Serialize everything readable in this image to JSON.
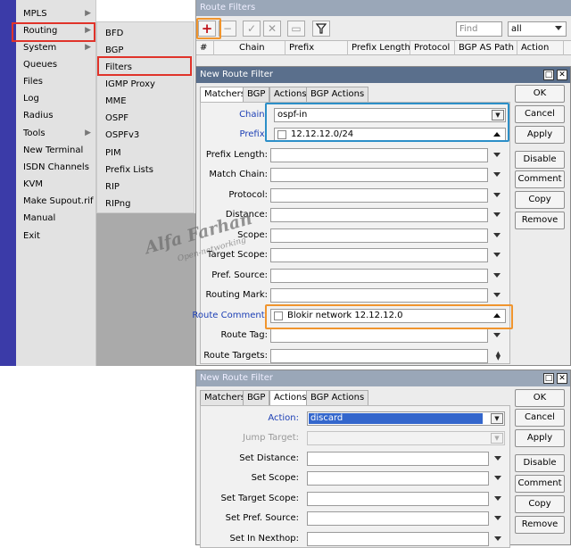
{
  "menu": {
    "items": [
      {
        "label": "MPLS",
        "arrow": true
      },
      {
        "label": "Routing",
        "arrow": true
      },
      {
        "label": "System",
        "arrow": true
      },
      {
        "label": "Queues",
        "arrow": false
      },
      {
        "label": "Files",
        "arrow": false
      },
      {
        "label": "Log",
        "arrow": false
      },
      {
        "label": "Radius",
        "arrow": false
      },
      {
        "label": "Tools",
        "arrow": true
      },
      {
        "label": "New Terminal",
        "arrow": false
      },
      {
        "label": "ISDN Channels",
        "arrow": false
      },
      {
        "label": "KVM",
        "arrow": false
      },
      {
        "label": "Make Supout.rif",
        "arrow": false
      },
      {
        "label": "Manual",
        "arrow": false
      },
      {
        "label": "Exit",
        "arrow": false
      }
    ]
  },
  "submenu": {
    "items": [
      "BFD",
      "BGP",
      "Filters",
      "IGMP Proxy",
      "MME",
      "OSPF",
      "OSPFv3",
      "PIM",
      "Prefix Lists",
      "RIP",
      "RIPng"
    ]
  },
  "route_filters": {
    "title": "Route Filters",
    "find_placeholder": "Find",
    "filter_value": "all",
    "columns": [
      "#",
      "Chain",
      "Prefix",
      "Prefix Length",
      "Protocol",
      "BGP AS Path",
      "Action"
    ]
  },
  "dialog1": {
    "title": "New Route Filter",
    "tabs": [
      "Matchers",
      "BGP",
      "Actions",
      "BGP Actions"
    ],
    "active_tab": "Matchers",
    "fields": [
      {
        "label": "Chain:",
        "value": "ospf-in"
      },
      {
        "label": "Prefix:",
        "value": "12.12.12.0/24"
      },
      {
        "label": "Prefix Length:",
        "value": ""
      },
      {
        "label": "Match Chain:",
        "value": ""
      },
      {
        "label": "Protocol:",
        "value": ""
      },
      {
        "label": "Distance:",
        "value": ""
      },
      {
        "label": "Scope:",
        "value": ""
      },
      {
        "label": "Target Scope:",
        "value": ""
      },
      {
        "label": "Pref. Source:",
        "value": ""
      },
      {
        "label": "Routing Mark:",
        "value": ""
      },
      {
        "label": "Route Comment:",
        "value": "Blokir network 12.12.12.0"
      },
      {
        "label": "Route Tag:",
        "value": ""
      },
      {
        "label": "Route Targets:",
        "value": ""
      }
    ],
    "buttons": [
      "OK",
      "Cancel",
      "Apply",
      "Disable",
      "Comment",
      "Copy",
      "Remove"
    ]
  },
  "dialog2": {
    "title": "New Route Filter",
    "tabs": [
      "Matchers",
      "BGP",
      "Actions",
      "BGP Actions"
    ],
    "active_tab": "Actions",
    "fields": [
      {
        "label": "Action:",
        "value": "discard"
      },
      {
        "label": "Jump Target:",
        "value": ""
      },
      {
        "label": "Set Distance:",
        "value": ""
      },
      {
        "label": "Set Scope:",
        "value": ""
      },
      {
        "label": "Set Target Scope:",
        "value": ""
      },
      {
        "label": "Set Pref. Source:",
        "value": ""
      },
      {
        "label": "Set In Nexthop:",
        "value": ""
      }
    ],
    "buttons": [
      "OK",
      "Cancel",
      "Apply",
      "Disable",
      "Comment",
      "Copy",
      "Remove"
    ]
  },
  "watermark": {
    "name": "Alfa Farhan",
    "subtitle": "Open-networking"
  },
  "colors": {
    "highlight_red": "#e0332a",
    "highlight_orange": "#f0952e",
    "highlight_blue": "#2c8fc8",
    "selection": "#3366cc",
    "sidebar": "#3b3ba8",
    "link_label": "#1c3fb5"
  },
  "icons": {
    "add": "plus-icon",
    "remove": "minus-icon",
    "enable": "check-icon",
    "disable": "cross-icon",
    "comment": "note-icon",
    "filter": "funnel-icon"
  }
}
